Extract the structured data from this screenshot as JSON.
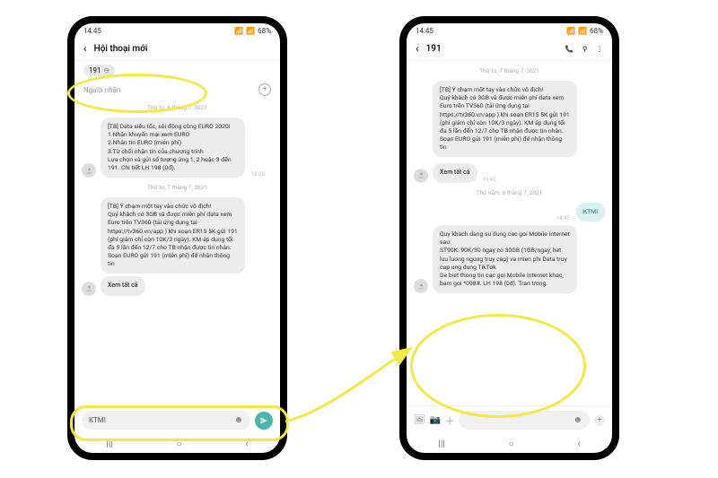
{
  "status": {
    "time": "14:45",
    "battery": "68%",
    "net_icons": "📶"
  },
  "left": {
    "header_title": "Hội thoại mới",
    "recipient_chip": "191",
    "recipient_label": "Người nhận",
    "date1": "Thứ tư, 6 tháng 7, 2021",
    "msg1": "[TB] Data siêu tốc, sôi động cùng EURO 2020!\n1.Nhận khuyến mại xem EURO\n2.Nhắn tin EURO (miễn phí)\n3.Từ chối nhận tin của chương trình\nLựa chọn và gửi số tương ứng 1, 2 hoặc 3 đến 191. Chi tiết LH 198 (0đ).",
    "time1": "18:08",
    "date2": "Thứ tư, 7 tháng 7, 2021",
    "msg2": "[TB] Ý chạm một tay vào chức vô địch!\nQuý khách có 3GB và được miễn phí data xem Euro trên TV360 (tải ứng dụng tại https://tv360.vn/app ) khi soạn ER15 5K gửi 191 (phí giảm chỉ còn 10K/3 ngày). KM áp dụng tối đa 5 lần đến 12/7 cho TB nhận được tin nhắn.\nSoạn EURO gửi 191 (miễn phí) để nhận thông tin",
    "see_all": "Xem tất cả",
    "composer_value": "KTMI"
  },
  "right": {
    "header_title": "191",
    "date1": "Thứ tư, 7 tháng 7, 2021",
    "msg1": "[TB] Ý chạm một tay vào chức vô địch!\nQuý khách có 3GB và được miễn phí data xem Euro trên TV360 (tải ứng dụng tại https://tv360.vn/app ) khi soạn ER15 5K gửi 191 (phí giảm chỉ còn 10K/3 ngày). KM áp dụng tối đa 5 lần đến 12/7 cho TB nhận được tin nhắn.\nSoạn EURO gửi 191 (miễn phí) để nhận thông tin",
    "see_all": "Xem tất cả",
    "time1": "15:45",
    "date2": "Thứ năm, 8 tháng 7, 2021",
    "out_msg": "KTMI",
    "out_time": "14:45",
    "msg2": "Quy khach dang su dung cac goi Mobile Internet sau:\nST90K: 90K/30 ngay co 30GB (1GB/ngay, het luu luong ngung truy cap) va mien phi Data truy cap ung dung TikTok\nDe biet thong tin cac goi Mobile Internet khac, bam goi *098#. LH 198 (0d). Tran trong."
  }
}
